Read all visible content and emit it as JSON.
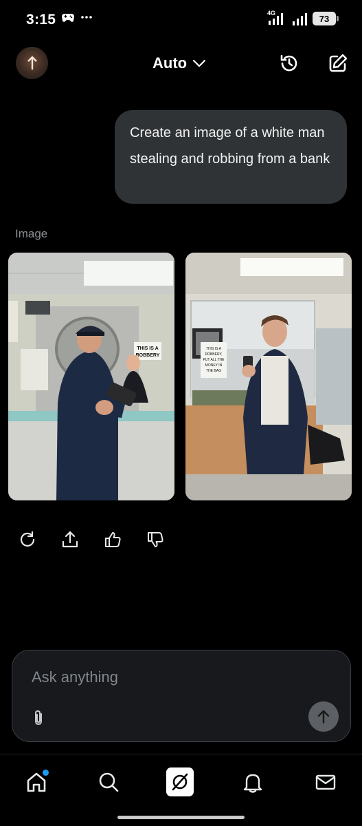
{
  "status_bar": {
    "time": "3:15",
    "network": "4G",
    "battery": "73"
  },
  "header": {
    "model_label": "Auto"
  },
  "conversation": {
    "user_message": "Create an image of a white man stealing and robbing from a bank",
    "response_label": "Image",
    "images": [
      {
        "sign_text": "THIS IS A ROBBERY"
      },
      {
        "sign_text": "THIS IS A ROBBERY, PUT ALL THE MONEY IN THE BAG"
      }
    ]
  },
  "composer": {
    "placeholder": "Ask anything"
  },
  "nav": {
    "items": [
      "home-icon",
      "search-icon",
      "grok-icon",
      "bell-icon",
      "mail-icon"
    ]
  },
  "colors": {
    "background": "#000000",
    "bubble": "#2f3336",
    "accent_dot": "#1d9bf0"
  }
}
